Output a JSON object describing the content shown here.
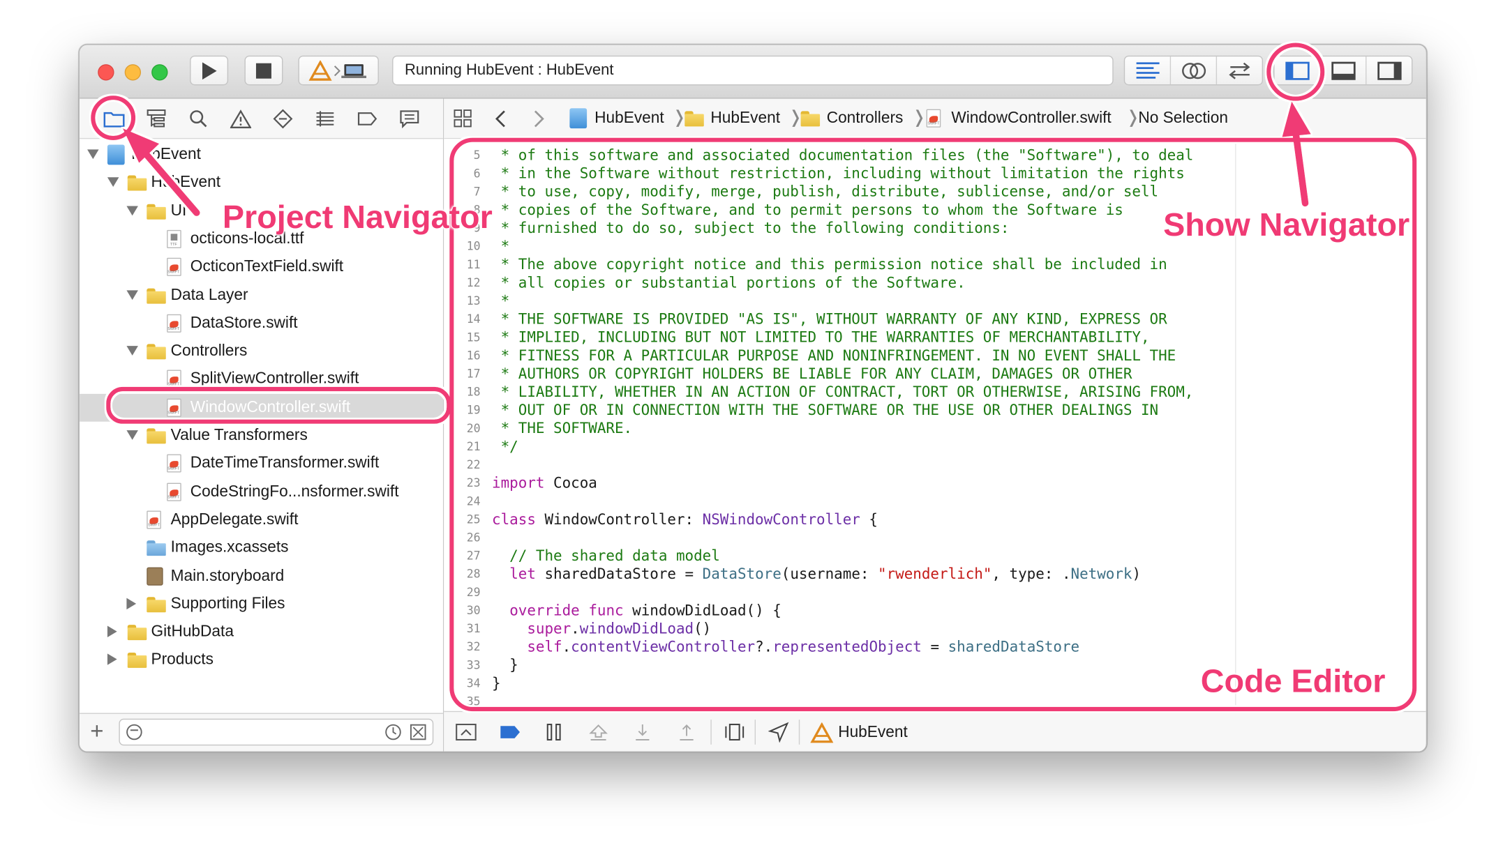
{
  "toolbar": {
    "activity_text": "Running HubEvent : HubEvent"
  },
  "navigator": {
    "tree": [
      {
        "label": "HubEvent",
        "kind": "project",
        "indent": 0,
        "disclosure": "down"
      },
      {
        "label": "HubEvent",
        "kind": "folder",
        "indent": 1,
        "disclosure": "down"
      },
      {
        "label": "UI",
        "kind": "folder",
        "indent": 2,
        "disclosure": "down"
      },
      {
        "label": "octicons-local.ttf",
        "kind": "ttf",
        "indent": 3,
        "disclosure": "none"
      },
      {
        "label": "OcticonTextField.swift",
        "kind": "swift",
        "indent": 3,
        "disclosure": "none"
      },
      {
        "label": "Data Layer",
        "kind": "folder",
        "indent": 2,
        "disclosure": "down"
      },
      {
        "label": "DataStore.swift",
        "kind": "swift",
        "indent": 3,
        "disclosure": "none"
      },
      {
        "label": "Controllers",
        "kind": "folder",
        "indent": 2,
        "disclosure": "down"
      },
      {
        "label": "SplitViewController.swift",
        "kind": "swift",
        "indent": 3,
        "disclosure": "none"
      },
      {
        "label": "WindowController.swift",
        "kind": "swift",
        "indent": 3,
        "disclosure": "none",
        "selected": true
      },
      {
        "label": "Value Transformers",
        "kind": "folder",
        "indent": 2,
        "disclosure": "down"
      },
      {
        "label": "DateTimeTransformer.swift",
        "kind": "swift",
        "indent": 3,
        "disclosure": "none"
      },
      {
        "label": "CodeStringFo...nsformer.swift",
        "kind": "swift",
        "indent": 3,
        "disclosure": "none"
      },
      {
        "label": "AppDelegate.swift",
        "kind": "swift",
        "indent": 2,
        "disclosure": "none"
      },
      {
        "label": "Images.xcassets",
        "kind": "assets",
        "indent": 2,
        "disclosure": "none"
      },
      {
        "label": "Main.storyboard",
        "kind": "storyboard",
        "indent": 2,
        "disclosure": "none"
      },
      {
        "label": "Supporting Files",
        "kind": "folder",
        "indent": 2,
        "disclosure": "right"
      },
      {
        "label": "GitHubData",
        "kind": "folder",
        "indent": 1,
        "disclosure": "right"
      },
      {
        "label": "Products",
        "kind": "folder",
        "indent": 1,
        "disclosure": "right"
      }
    ]
  },
  "jumpbar": {
    "crumbs": [
      "HubEvent",
      "HubEvent",
      "Controllers",
      "WindowController.swift",
      "No Selection"
    ]
  },
  "editor": {
    "lines": [
      {
        "n": "5",
        "tokens": [
          [
            " * of this software and associated documentation files (the \"Software\"), to deal",
            "com"
          ]
        ]
      },
      {
        "n": "6",
        "tokens": [
          [
            " * in the Software without restriction, including without limitation the rights",
            "com"
          ]
        ]
      },
      {
        "n": "7",
        "tokens": [
          [
            " * to use, copy, modify, merge, publish, distribute, sublicense, and/or sell",
            "com"
          ]
        ]
      },
      {
        "n": "8",
        "tokens": [
          [
            " * copies of the Software, and to permit persons to whom the Software is",
            "com"
          ]
        ]
      },
      {
        "n": "9",
        "tokens": [
          [
            " * furnished to do so, subject to the following conditions:",
            "com"
          ]
        ]
      },
      {
        "n": "10",
        "tokens": [
          [
            " *",
            "com"
          ]
        ]
      },
      {
        "n": "11",
        "tokens": [
          [
            " * The above copyright notice and this permission notice shall be included in",
            "com"
          ]
        ]
      },
      {
        "n": "12",
        "tokens": [
          [
            " * all copies or substantial portions of the Software.",
            "com"
          ]
        ]
      },
      {
        "n": "13",
        "tokens": [
          [
            " *",
            "com"
          ]
        ]
      },
      {
        "n": "14",
        "tokens": [
          [
            " * THE SOFTWARE IS PROVIDED \"AS IS\", WITHOUT WARRANTY OF ANY KIND, EXPRESS OR",
            "com"
          ]
        ]
      },
      {
        "n": "15",
        "tokens": [
          [
            " * IMPLIED, INCLUDING BUT NOT LIMITED TO THE WARRANTIES OF MERCHANTABILITY,",
            "com"
          ]
        ]
      },
      {
        "n": "16",
        "tokens": [
          [
            " * FITNESS FOR A PARTICULAR PURPOSE AND NONINFRINGEMENT. IN NO EVENT SHALL THE",
            "com"
          ]
        ]
      },
      {
        "n": "17",
        "tokens": [
          [
            " * AUTHORS OR COPYRIGHT HOLDERS BE LIABLE FOR ANY CLAIM, DAMAGES OR OTHER",
            "com"
          ]
        ]
      },
      {
        "n": "18",
        "tokens": [
          [
            " * LIABILITY, WHETHER IN AN ACTION OF CONTRACT, TORT OR OTHERWISE, ARISING FROM,",
            "com"
          ]
        ]
      },
      {
        "n": "19",
        "tokens": [
          [
            " * OUT OF OR IN CONNECTION WITH THE SOFTWARE OR THE USE OR OTHER DEALINGS IN",
            "com"
          ]
        ]
      },
      {
        "n": "20",
        "tokens": [
          [
            " * THE SOFTWARE.",
            "com"
          ]
        ]
      },
      {
        "n": "21",
        "tokens": [
          [
            " */",
            "com"
          ]
        ]
      },
      {
        "n": "22",
        "tokens": []
      },
      {
        "n": "23",
        "tokens": [
          [
            "import",
            "kw"
          ],
          [
            " Cocoa",
            "plain"
          ]
        ]
      },
      {
        "n": "24",
        "tokens": []
      },
      {
        "n": "25",
        "tokens": [
          [
            "class",
            "kw"
          ],
          [
            " WindowController: ",
            "plain"
          ],
          [
            "NSWindowController",
            "type"
          ],
          [
            " {",
            "plain"
          ]
        ]
      },
      {
        "n": "26",
        "tokens": []
      },
      {
        "n": "27",
        "tokens": [
          [
            "  // The shared data model",
            "com"
          ]
        ]
      },
      {
        "n": "28",
        "tokens": [
          [
            "  ",
            "plain"
          ],
          [
            "let",
            "kw"
          ],
          [
            " sharedDataStore = ",
            "plain"
          ],
          [
            "DataStore",
            "prop"
          ],
          [
            "(username: ",
            "plain"
          ],
          [
            "\"rwenderlich\"",
            "str"
          ],
          [
            ", type: .",
            "plain"
          ],
          [
            "Network",
            "prop"
          ],
          [
            ")",
            "plain"
          ]
        ]
      },
      {
        "n": "29",
        "tokens": []
      },
      {
        "n": "30",
        "tokens": [
          [
            "  ",
            "plain"
          ],
          [
            "override",
            "kw"
          ],
          [
            " ",
            "plain"
          ],
          [
            "func",
            "kw"
          ],
          [
            " windowDidLoad() {",
            "plain"
          ]
        ]
      },
      {
        "n": "31",
        "tokens": [
          [
            "    ",
            "plain"
          ],
          [
            "super",
            "kw"
          ],
          [
            ".",
            "plain"
          ],
          [
            "windowDidLoad",
            "type"
          ],
          [
            "()",
            "plain"
          ]
        ]
      },
      {
        "n": "32",
        "tokens": [
          [
            "    ",
            "plain"
          ],
          [
            "self",
            "kw"
          ],
          [
            ".",
            "plain"
          ],
          [
            "contentViewController",
            "type"
          ],
          [
            "?.",
            "plain"
          ],
          [
            "representedObject",
            "type"
          ],
          [
            " = ",
            "plain"
          ],
          [
            "sharedDataStore",
            "prop"
          ]
        ]
      },
      {
        "n": "33",
        "tokens": [
          [
            "  }",
            "plain"
          ]
        ]
      },
      {
        "n": "34",
        "tokens": [
          [
            "}",
            "plain"
          ]
        ]
      },
      {
        "n": "35",
        "tokens": []
      }
    ]
  },
  "debugbar": {
    "scheme_label": "HubEvent"
  },
  "annotations": {
    "project_navigator": "Project Navigator",
    "show_navigator": "Show Navigator",
    "code_editor": "Code Editor"
  },
  "colors": {
    "accent": "#f03a74",
    "comment": "#1c7a12",
    "keyword": "#aa1b9c",
    "string": "#c41a16",
    "traffic_red": "#fc5753",
    "traffic_yellow": "#fdbc40",
    "traffic_green": "#33c748"
  },
  "icons": {
    "toolbar": [
      "play-icon",
      "stop-icon",
      "scheme-icon",
      "standard-editor-icon",
      "assistant-editor-icon",
      "version-editor-icon",
      "left-panel-icon",
      "bottom-panel-icon",
      "right-panel-icon"
    ],
    "navigator_tabs": [
      "folder-icon",
      "hierarchy-icon",
      "search-icon",
      "warning-icon",
      "test-icon",
      "debug-icon",
      "breakpoint-icon",
      "report-icon"
    ]
  }
}
